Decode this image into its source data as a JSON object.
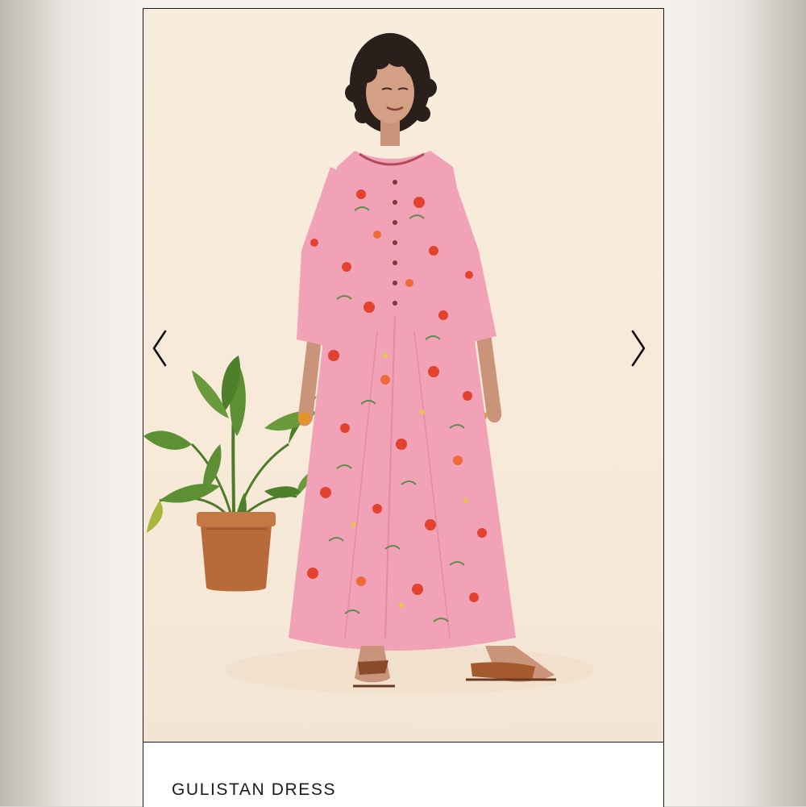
{
  "product": {
    "title": "GULISTAN DRESS"
  },
  "gallery": {
    "prev_icon": "chevron-left-icon",
    "next_icon": "chevron-right-icon",
    "image_subject": "model-in-pink-floral-dress-photo"
  },
  "colors": {
    "photo_background": "#f7ead9",
    "dress_pink": "#f2a2b6",
    "border": "#1b1b1b",
    "text": "#1a1a1a"
  }
}
